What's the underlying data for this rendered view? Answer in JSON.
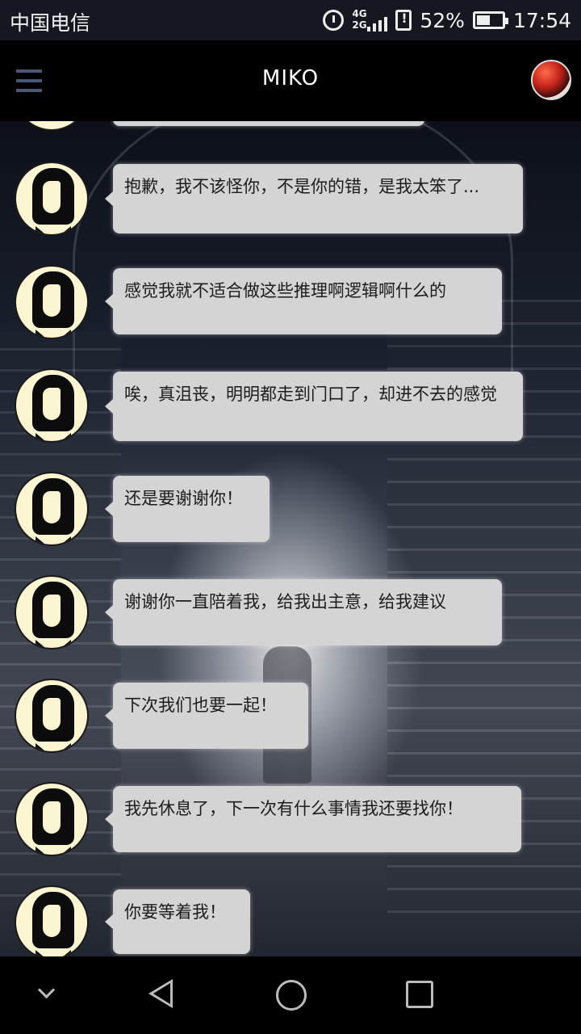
{
  "status_bar": {
    "carrier": "中国电信",
    "network_top": "4G",
    "network_bottom": "2G",
    "battery_percent": "52%",
    "battery_level": 0.52,
    "time": "17:54",
    "icons": [
      "alarm-icon",
      "signal-icon",
      "sim-alert-icon",
      "battery-icon"
    ]
  },
  "app_bar": {
    "title": "MIKO",
    "menu_icon": "hamburger-menu-icon",
    "profile_icon": "user-avatar"
  },
  "messages": [
    {
      "sender": "MIKO",
      "text": "抱歉，我不该怪你，不是你的错，是我太笨了..."
    },
    {
      "sender": "MIKO",
      "text": "感觉我就不适合做这些推理啊逻辑啊什么的"
    },
    {
      "sender": "MIKO",
      "text": "唉，真沮丧，明明都走到门口了，却进不去的感觉"
    },
    {
      "sender": "MIKO",
      "text": "还是要谢谢你！"
    },
    {
      "sender": "MIKO",
      "text": "谢谢你一直陪着我，给我出主意，给我建议"
    },
    {
      "sender": "MIKO",
      "text": "下次我们也要一起！"
    },
    {
      "sender": "MIKO",
      "text": "我先休息了，下一次有什么事情我还要找你！"
    },
    {
      "sender": "MIKO",
      "text": "你要等着我！"
    }
  ],
  "nav_bar": {
    "icons": [
      "collapse-chevron-icon",
      "back-icon",
      "home-icon",
      "recents-icon"
    ]
  }
}
